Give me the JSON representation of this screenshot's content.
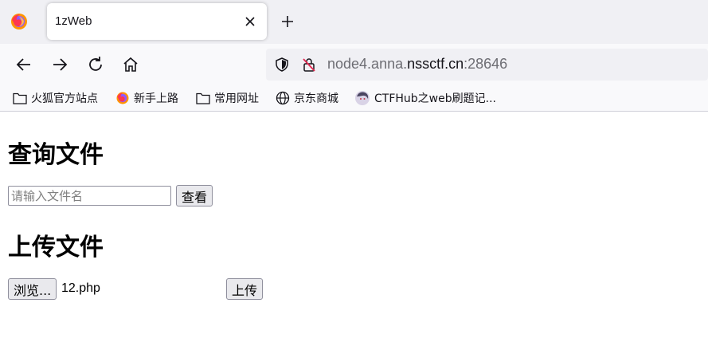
{
  "browser": {
    "tab": {
      "title": "1zWeb"
    },
    "url": {
      "host_prefix": "node4.anna.",
      "host_domain": "nssctf.cn",
      "port": ":28646"
    },
    "bookmarks": [
      {
        "label": "火狐官方站点",
        "icon": "folder-icon"
      },
      {
        "label": "新手上路",
        "icon": "firefox-icon"
      },
      {
        "label": "常用网址",
        "icon": "folder-icon"
      },
      {
        "label": "京东商城",
        "icon": "globe-icon"
      },
      {
        "label": "CTFHub之web刷题记...",
        "icon": "avatar-icon"
      }
    ]
  },
  "page": {
    "query_heading": "查询文件",
    "name_input_placeholder": "请输入文件名",
    "view_button": "查看",
    "upload_heading": "上传文件",
    "browse_button": "浏览...",
    "selected_file": "12.php",
    "upload_button": "上传"
  },
  "colors": {
    "accent": "#ff7139",
    "tab_bg": "#f0f0f4",
    "toolbar_bg": "#f9f9fb"
  }
}
